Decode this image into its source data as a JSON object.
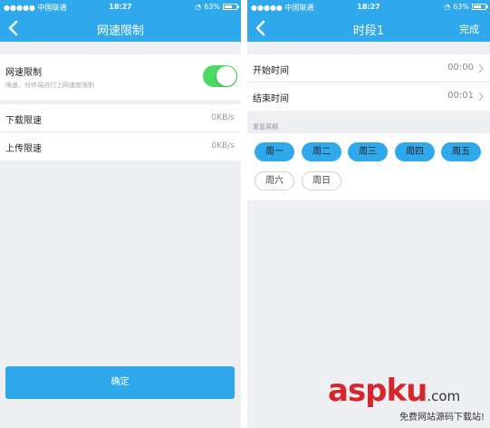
{
  "status": {
    "carrier": "●●●●● 中国联通",
    "time": "18:27",
    "battery": "63%",
    "battery_level": 0.63
  },
  "left": {
    "title": "网速限制",
    "limit": {
      "label": "网速限制",
      "description": "限速，对终端进行上网速度限制",
      "enabled": true
    },
    "download": {
      "label": "下载限速",
      "value": "0KB/s"
    },
    "upload": {
      "label": "上传限速",
      "value": "0KB/s"
    },
    "confirm_label": "确定"
  },
  "right": {
    "title": "时段1",
    "done_label": "完成",
    "start": {
      "label": "开始时间",
      "value": "00:00"
    },
    "end": {
      "label": "结束时间",
      "value": "00:01"
    },
    "repeat_title": "重复周期",
    "days": [
      {
        "label": "周一",
        "selected": true
      },
      {
        "label": "周二",
        "selected": true
      },
      {
        "label": "周三",
        "selected": true
      },
      {
        "label": "周四",
        "selected": true
      },
      {
        "label": "周五",
        "selected": true
      },
      {
        "label": "周六",
        "selected": false
      },
      {
        "label": "周日",
        "selected": false
      }
    ]
  },
  "watermark": {
    "brand_main": "aspku",
    "brand_suffix": ".com",
    "slogan": "免费网站源码下载站!"
  },
  "colors": {
    "accent": "#2fa8ec",
    "toggle_on": "#4cd964",
    "background": "#eeeff3",
    "watermark": "#d6262d"
  }
}
